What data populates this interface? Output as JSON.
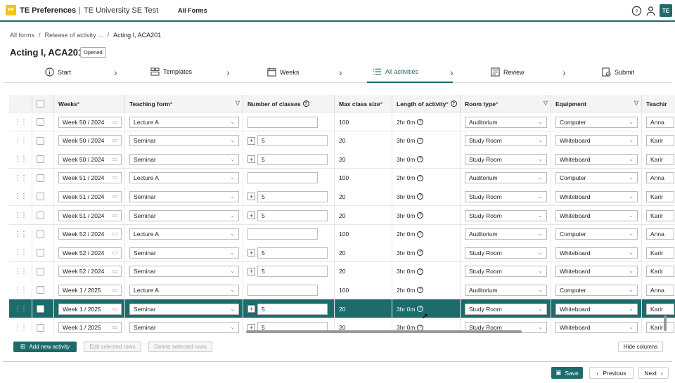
{
  "header": {
    "logo_text": "PF",
    "app_title": "TE Preferences",
    "separator": "|",
    "org_name": "TE University SE Test",
    "all_forms": "All Forms",
    "avatar_initials": "TE"
  },
  "breadcrumb": {
    "items": [
      "All forms",
      "/",
      "Release of activity ...",
      "/",
      "Acting I, ACA201"
    ]
  },
  "page": {
    "title": "Acting I, ACA201",
    "status": "Opened"
  },
  "steps": [
    {
      "label": "Start"
    },
    {
      "label": "Templates"
    },
    {
      "label": "Weeks"
    },
    {
      "label": "All activities"
    },
    {
      "label": "Review"
    },
    {
      "label": "Submit"
    }
  ],
  "columns": {
    "weeks": "Weeks",
    "teaching_form": "Teaching form",
    "num_classes": "Number of classes",
    "max_class_size": "Max class size",
    "length": "Length of activity",
    "room_type": "Room type",
    "equipment": "Equipment",
    "teacher": "Teachir",
    "required_mark": "*"
  },
  "rows": [
    {
      "week": "Week 50 / 2024",
      "form": "Lecture A",
      "classes": "",
      "plus": false,
      "size": "100",
      "length": "2hr 0m",
      "room": "Auditorium",
      "equip": "Computer",
      "teacher": "Anna"
    },
    {
      "week": "Week 50 / 2024",
      "form": "Seminar",
      "classes": "5",
      "plus": true,
      "size": "20",
      "length": "3hr 0m",
      "room": "Study Room",
      "equip": "Whiteboard",
      "teacher": "Karir"
    },
    {
      "week": "Week 50 / 2024",
      "form": "Seminar",
      "classes": "5",
      "plus": true,
      "size": "20",
      "length": "3hr 0m",
      "room": "Study Room",
      "equip": "Whiteboard",
      "teacher": "Karir"
    },
    {
      "week": "Week 51 / 2024",
      "form": "Lecture A",
      "classes": "",
      "plus": false,
      "size": "100",
      "length": "2hr 0m",
      "room": "Auditorium",
      "equip": "Computer",
      "teacher": "Anna"
    },
    {
      "week": "Week 51 / 2024",
      "form": "Seminar",
      "classes": "5",
      "plus": true,
      "size": "20",
      "length": "3hr 0m",
      "room": "Study Room",
      "equip": "Whiteboard",
      "teacher": "Karir"
    },
    {
      "week": "Week 51 / 2024",
      "form": "Seminar",
      "classes": "5",
      "plus": true,
      "size": "20",
      "length": "3hr 0m",
      "room": "Study Room",
      "equip": "Whiteboard",
      "teacher": "Karir"
    },
    {
      "week": "Week 52 / 2024",
      "form": "Lecture A",
      "classes": "",
      "plus": false,
      "size": "100",
      "length": "2hr 0m",
      "room": "Auditorium",
      "equip": "Computer",
      "teacher": "Anna"
    },
    {
      "week": "Week 52 / 2024",
      "form": "Seminar",
      "classes": "5",
      "plus": true,
      "size": "20",
      "length": "3hr 0m",
      "room": "Study Room",
      "equip": "Whiteboard",
      "teacher": "Karir"
    },
    {
      "week": "Week 52 / 2024",
      "form": "Seminar",
      "classes": "5",
      "plus": true,
      "size": "20",
      "length": "3hr 0m",
      "room": "Study Room",
      "equip": "Whiteboard",
      "teacher": "Karir"
    },
    {
      "week": "Week 1 / 2025",
      "form": "Lecture A",
      "classes": "",
      "plus": false,
      "size": "100",
      "length": "2hr 0m",
      "room": "Auditorium",
      "equip": "Computer",
      "teacher": "Anna"
    },
    {
      "week": "Week 1 / 2025",
      "form": "Seminar",
      "classes": "5",
      "plus": true,
      "size": "20",
      "length": "3hr 0m",
      "room": "Study Room",
      "equip": "Whiteboard",
      "teacher": "Karir",
      "selected": true
    },
    {
      "week": "Week 1 / 2025",
      "form": "Seminar",
      "classes": "5",
      "plus": true,
      "size": "20",
      "length": "3hr 0m",
      "room": "Study Room",
      "equip": "Whiteboard",
      "teacher": "Karir"
    }
  ],
  "actions": {
    "add": "Add new activity",
    "edit": "Edit selected rows",
    "delete": "Delete selected rows",
    "hide_columns": "Hide columns"
  },
  "footer": {
    "save": "Save",
    "previous": "Previous",
    "next": "Next"
  },
  "colors": {
    "accent": "#1e6b6b",
    "required": "#d33"
  }
}
